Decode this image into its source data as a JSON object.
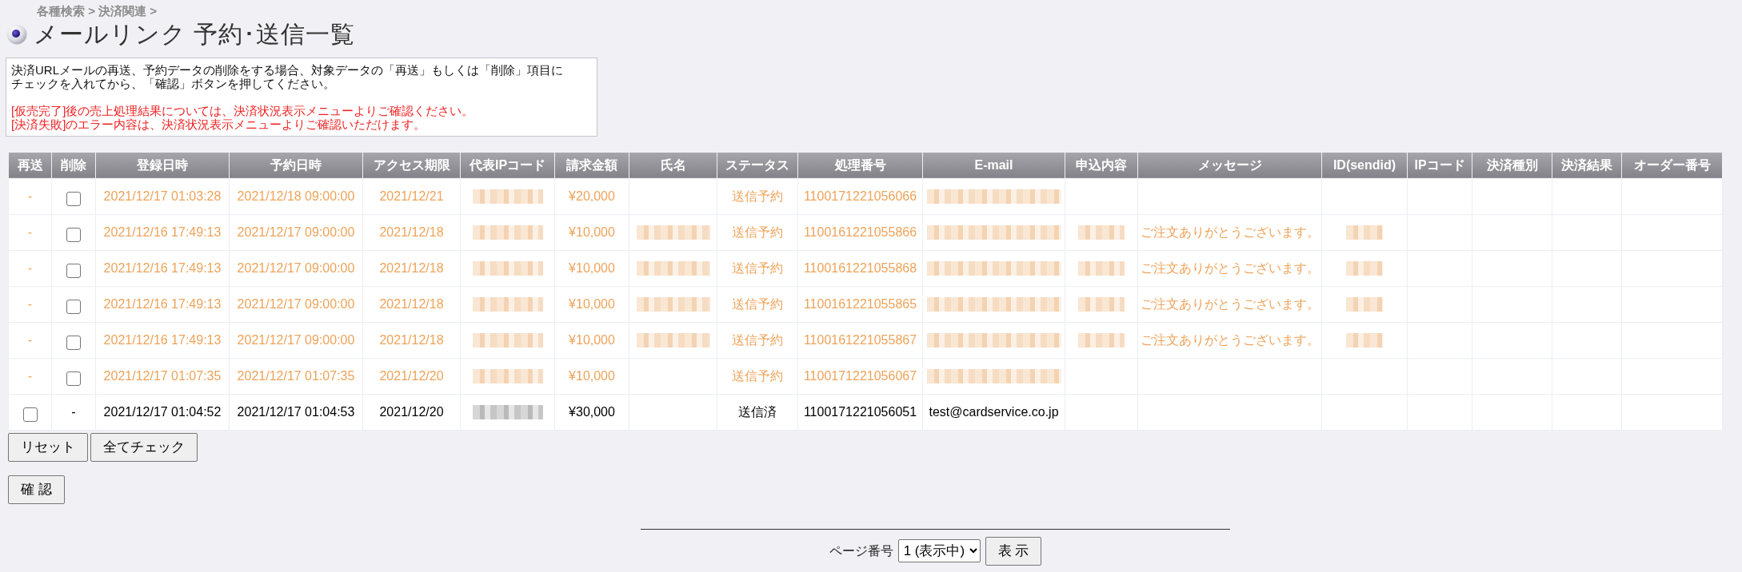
{
  "breadcrumb": "各種検索 > 決済関連 >",
  "title": "メールリンク 予約･送信一覧",
  "notice": [
    {
      "kind": "info",
      "text": "決済URLメールの再送、予約データの削除をする場合、対象データの「再送」もしくは「削除」項目にチェックを入れてから、「確認」ボタンを押してください。"
    },
    {
      "kind": "alert",
      "text": "[仮売完了]後の売上処理結果については、決済状況表示メニューよりご確認ください。"
    },
    {
      "kind": "alert",
      "text": "[決済失敗]のエラー内容は、決済状況表示メニューよりご確認いただけます。"
    }
  ],
  "table": {
    "columns": [
      "再送",
      "削除",
      "登録日時",
      "予約日時",
      "アクセス期限",
      "代表IPコード",
      "請求金額",
      "氏名",
      "ステータス",
      "処理番号",
      "E-mail",
      "申込内容",
      "メッセージ",
      "ID(sendid)",
      "IPコード",
      "決済種別",
      "決済結果",
      "オーダー番号"
    ],
    "rows": [
      {
        "kind": "scheduled",
        "cells": [
          {
            "kind": "text",
            "text": "-"
          },
          {
            "kind": "checkbox",
            "checked": false
          },
          {
            "kind": "text",
            "text": "2021/12/17 01:03:28"
          },
          {
            "kind": "text",
            "text": "2021/12/18 09:00:00"
          },
          {
            "kind": "text",
            "text": "2021/12/21"
          },
          {
            "kind": "blurred"
          },
          {
            "kind": "text",
            "text": "¥20,000"
          },
          null,
          {
            "kind": "text",
            "text": "送信予約"
          },
          {
            "kind": "text",
            "text": "1100171221056066"
          },
          {
            "kind": "blurred"
          },
          null,
          null,
          null,
          null,
          null,
          null,
          null
        ]
      },
      {
        "kind": "scheduled",
        "cells": [
          {
            "kind": "text",
            "text": "-"
          },
          {
            "kind": "checkbox",
            "checked": false
          },
          {
            "kind": "text",
            "text": "2021/12/16 17:49:13"
          },
          {
            "kind": "text",
            "text": "2021/12/17 09:00:00"
          },
          {
            "kind": "text",
            "text": "2021/12/18"
          },
          {
            "kind": "blurred"
          },
          {
            "kind": "text",
            "text": "¥10,000"
          },
          {
            "kind": "blurred"
          },
          {
            "kind": "text",
            "text": "送信予約"
          },
          {
            "kind": "text",
            "text": "1100161221055866"
          },
          {
            "kind": "blurred"
          },
          {
            "kind": "blurred"
          },
          {
            "kind": "text",
            "text": "ご注文ありがとうございます。"
          },
          {
            "kind": "blurred"
          },
          null,
          null,
          null,
          null
        ]
      },
      {
        "kind": "scheduled",
        "cells": [
          {
            "kind": "text",
            "text": "-"
          },
          {
            "kind": "checkbox",
            "checked": false
          },
          {
            "kind": "text",
            "text": "2021/12/16 17:49:13"
          },
          {
            "kind": "text",
            "text": "2021/12/17 09:00:00"
          },
          {
            "kind": "text",
            "text": "2021/12/18"
          },
          {
            "kind": "blurred"
          },
          {
            "kind": "text",
            "text": "¥10,000"
          },
          {
            "kind": "blurred"
          },
          {
            "kind": "text",
            "text": "送信予約"
          },
          {
            "kind": "text",
            "text": "1100161221055868"
          },
          {
            "kind": "blurred"
          },
          {
            "kind": "blurred"
          },
          {
            "kind": "text",
            "text": "ご注文ありがとうございます。"
          },
          {
            "kind": "blurred"
          },
          null,
          null,
          null,
          null
        ]
      },
      {
        "kind": "scheduled",
        "cells": [
          {
            "kind": "text",
            "text": "-"
          },
          {
            "kind": "checkbox",
            "checked": false
          },
          {
            "kind": "text",
            "text": "2021/12/16 17:49:13"
          },
          {
            "kind": "text",
            "text": "2021/12/17 09:00:00"
          },
          {
            "kind": "text",
            "text": "2021/12/18"
          },
          {
            "kind": "blurred"
          },
          {
            "kind": "text",
            "text": "¥10,000"
          },
          {
            "kind": "blurred"
          },
          {
            "kind": "text",
            "text": "送信予約"
          },
          {
            "kind": "text",
            "text": "1100161221055865"
          },
          {
            "kind": "blurred"
          },
          {
            "kind": "blurred"
          },
          {
            "kind": "text",
            "text": "ご注文ありがとうございます。"
          },
          {
            "kind": "blurred"
          },
          null,
          null,
          null,
          null
        ]
      },
      {
        "kind": "scheduled",
        "cells": [
          {
            "kind": "text",
            "text": "-"
          },
          {
            "kind": "checkbox",
            "checked": false
          },
          {
            "kind": "text",
            "text": "2021/12/16 17:49:13"
          },
          {
            "kind": "text",
            "text": "2021/12/17 09:00:00"
          },
          {
            "kind": "text",
            "text": "2021/12/18"
          },
          {
            "kind": "blurred"
          },
          {
            "kind": "text",
            "text": "¥10,000"
          },
          {
            "kind": "blurred"
          },
          {
            "kind": "text",
            "text": "送信予約"
          },
          {
            "kind": "text",
            "text": "1100161221055867"
          },
          {
            "kind": "blurred"
          },
          {
            "kind": "blurred"
          },
          {
            "kind": "text",
            "text": "ご注文ありがとうございます。"
          },
          {
            "kind": "blurred"
          },
          null,
          null,
          null,
          null
        ]
      },
      {
        "kind": "scheduled",
        "cells": [
          {
            "kind": "text",
            "text": "-"
          },
          {
            "kind": "checkbox",
            "checked": false
          },
          {
            "kind": "text",
            "text": "2021/12/17 01:07:35"
          },
          {
            "kind": "text",
            "text": "2021/12/17 01:07:35"
          },
          {
            "kind": "text",
            "text": "2021/12/20"
          },
          {
            "kind": "blurred"
          },
          {
            "kind": "text",
            "text": "¥10,000"
          },
          null,
          {
            "kind": "text",
            "text": "送信予約"
          },
          {
            "kind": "text",
            "text": "1100171221056067"
          },
          {
            "kind": "blurred"
          },
          null,
          null,
          null,
          null,
          null,
          null,
          null
        ]
      },
      {
        "kind": "sent",
        "cells": [
          {
            "kind": "checkbox",
            "checked": false
          },
          {
            "kind": "text",
            "text": "-"
          },
          {
            "kind": "text",
            "text": "2021/12/17 01:04:52"
          },
          {
            "kind": "text",
            "text": "2021/12/17 01:04:53"
          },
          {
            "kind": "text",
            "text": "2021/12/20"
          },
          {
            "kind": "blurred"
          },
          {
            "kind": "text",
            "text": "¥30,000"
          },
          null,
          {
            "kind": "text",
            "text": "送信済"
          },
          {
            "kind": "text",
            "text": "1100171221056051"
          },
          {
            "kind": "text",
            "text": "test@cardservice.co.jp"
          },
          null,
          null,
          null,
          null,
          null,
          null,
          null
        ]
      }
    ]
  },
  "table_buttons": [
    {
      "label": "リセット"
    },
    {
      "label": "全てチェック"
    }
  ],
  "confirm_button": {
    "label": "確 認"
  },
  "pagination": {
    "label": "ページ番号",
    "select": "1 (表示中)",
    "button": "表 示"
  }
}
